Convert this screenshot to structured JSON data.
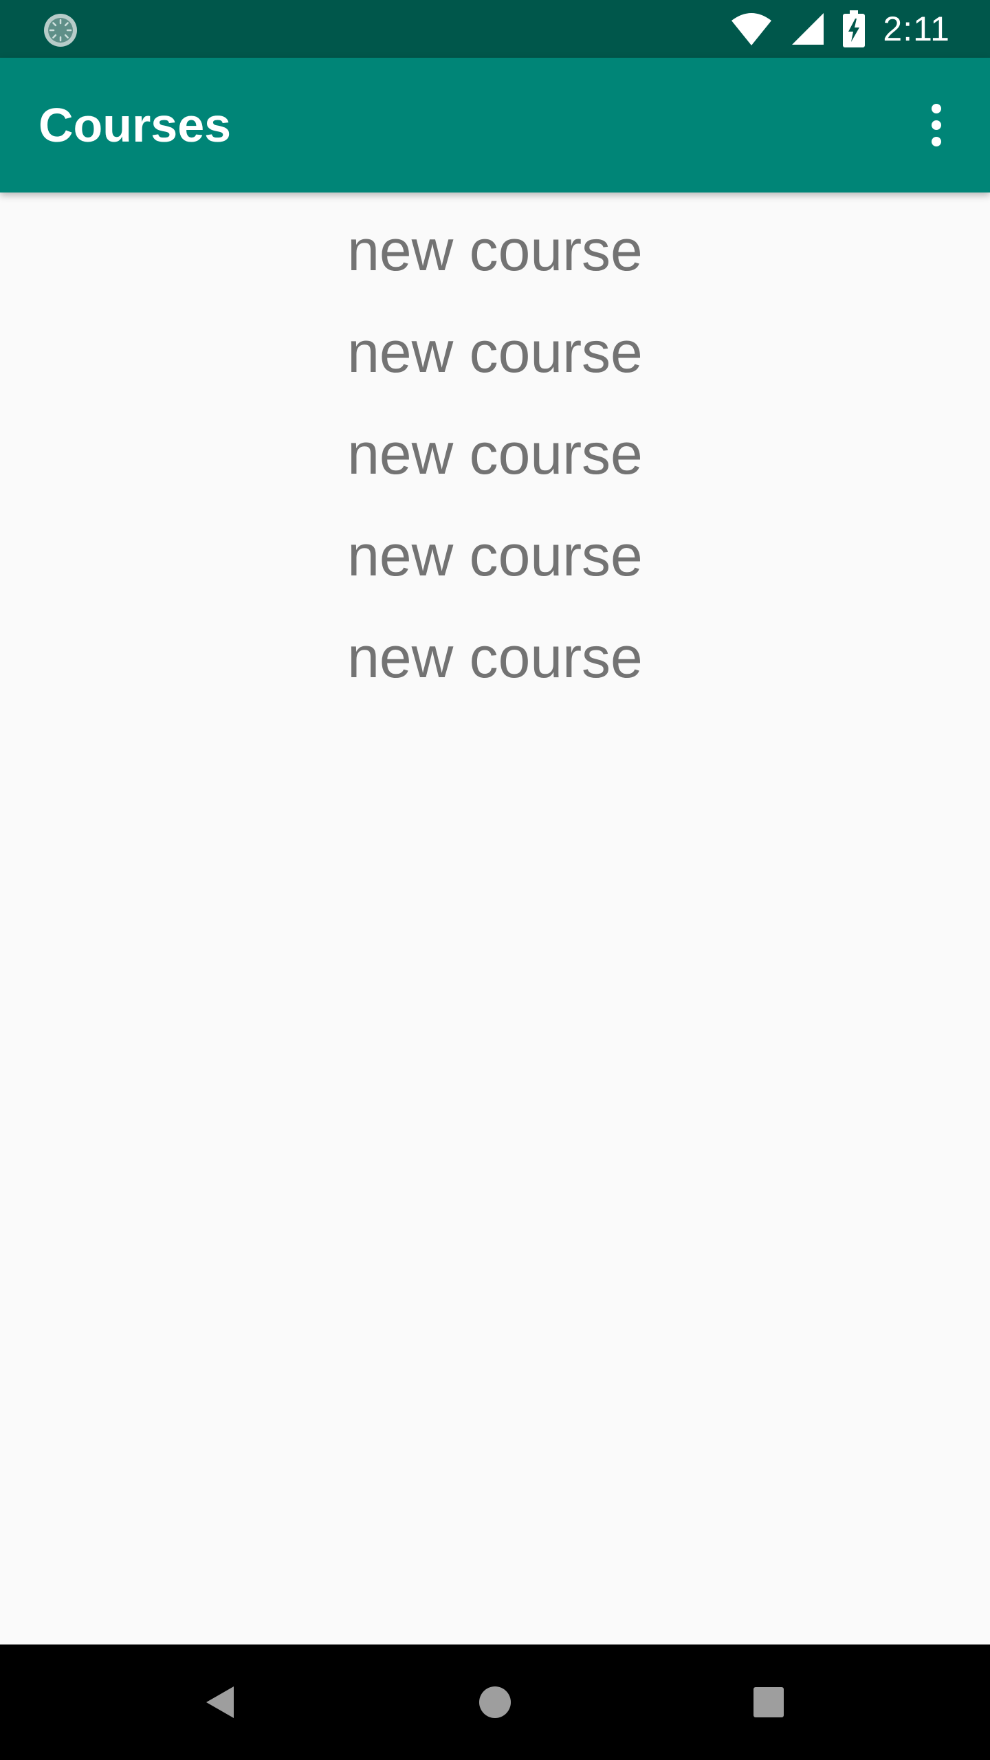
{
  "status_bar": {
    "time": "2:11",
    "icons": [
      "sync-icon",
      "wifi-icon",
      "cellular-signal-icon",
      "battery-charging-icon"
    ]
  },
  "app_bar": {
    "title": "Courses",
    "overflow_icon": "more-vert-icon"
  },
  "courses": [
    {
      "label": "new course"
    },
    {
      "label": "new course"
    },
    {
      "label": "new course"
    },
    {
      "label": "new course"
    },
    {
      "label": "new course"
    }
  ],
  "nav_bar": {
    "icons": [
      "back-icon",
      "home-icon",
      "recents-icon"
    ]
  },
  "colors": {
    "status_bar": "#00574b",
    "app_bar": "#008577",
    "background": "#fafafa",
    "item_text": "#737373",
    "nav_bar": "#000000"
  }
}
